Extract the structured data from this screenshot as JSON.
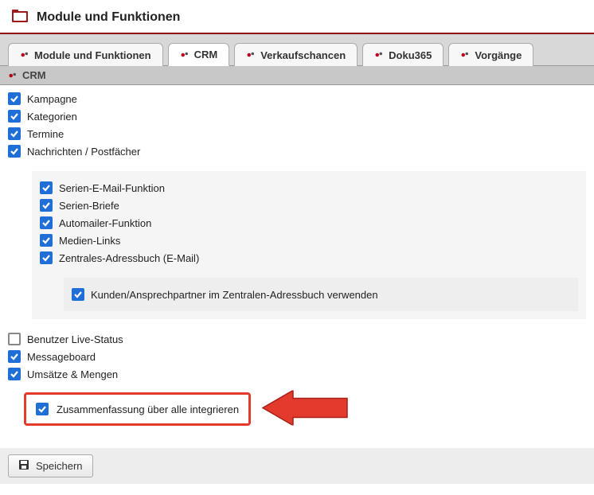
{
  "header": {
    "title": "Module und Funktionen"
  },
  "tabs": [
    {
      "label": "Module und Funktionen",
      "icon": "gear"
    },
    {
      "label": "CRM",
      "icon": "gear",
      "active": true
    },
    {
      "label": "Verkaufschancen",
      "icon": "gear"
    },
    {
      "label": "Doku365",
      "icon": "gear"
    },
    {
      "label": "Vorgänge",
      "icon": "gear"
    }
  ],
  "section_head": "CRM",
  "items": {
    "kampagne": {
      "label": "Kampagne",
      "checked": true
    },
    "kategorien": {
      "label": "Kategorien",
      "checked": true
    },
    "termine": {
      "label": "Termine",
      "checked": true
    },
    "nachrichten": {
      "label": "Nachrichten / Postfächer",
      "checked": true
    },
    "serien_email": {
      "label": "Serien-E-Mail-Funktion",
      "checked": true
    },
    "serien_briefe": {
      "label": "Serien-Briefe",
      "checked": true
    },
    "automailer": {
      "label": "Automailer-Funktion",
      "checked": true
    },
    "medien_links": {
      "label": "Medien-Links",
      "checked": true
    },
    "zentrales_adressbuch": {
      "label": "Zentrales-Adressbuch (E-Mail)",
      "checked": true
    },
    "kunden_ansprechpartner": {
      "label": "Kunden/Ansprechpartner im Zentralen-Adressbuch verwenden",
      "checked": true
    },
    "benutzer_live": {
      "label": "Benutzer Live-Status",
      "checked": false
    },
    "messageboard": {
      "label": "Messageboard",
      "checked": true
    },
    "umsaetze": {
      "label": "Umsätze & Mengen",
      "checked": true
    },
    "zusammenfassung": {
      "label": "Zusammenfassung über alle integrieren",
      "checked": true
    }
  },
  "footer": {
    "save_label": "Speichern"
  },
  "colors": {
    "accent": "#1f6fd6",
    "highlight": "#e23b2e",
    "header_rule": "#8b0000"
  }
}
